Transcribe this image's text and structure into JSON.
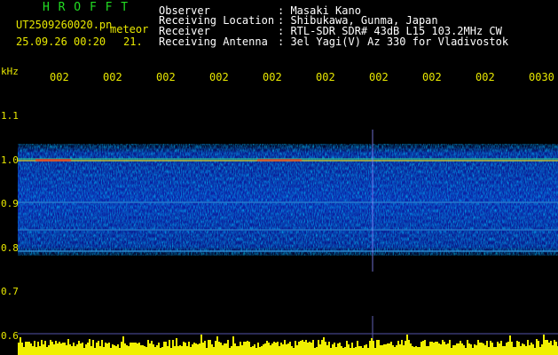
{
  "app": {
    "title": "H R O F F T",
    "file_name": "UT2509260020.pn",
    "mode": "meteor",
    "datetime": "25.09.26 00:20",
    "count": "21."
  },
  "info": [
    {
      "label": "Observer",
      "value": ": Masaki Kano"
    },
    {
      "label": "Receiving Location",
      "value": ": Shibukawa, Gunma, Japan"
    },
    {
      "label": "Receiver",
      "value": ": RTL-SDR SDR# 43dB L15 103.2MHz CW"
    },
    {
      "label": "Receiving Antenna",
      "value": ": 3el Yagi(V) Az 330 for Vladivostok"
    }
  ],
  "time_ticks": [
    "002",
    "002",
    "002",
    "002",
    "002",
    "002",
    "002",
    "002",
    "002",
    "0030"
  ],
  "y_axis": {
    "unit": "kHz",
    "labels": [
      "1.1",
      "1.0",
      "0.9",
      "0.8",
      "0.7",
      "0.6"
    ]
  },
  "colors": {
    "label": "#e8e800",
    "title": "#22dd22",
    "text": "#ffffff",
    "marker": "#8888ff"
  }
}
